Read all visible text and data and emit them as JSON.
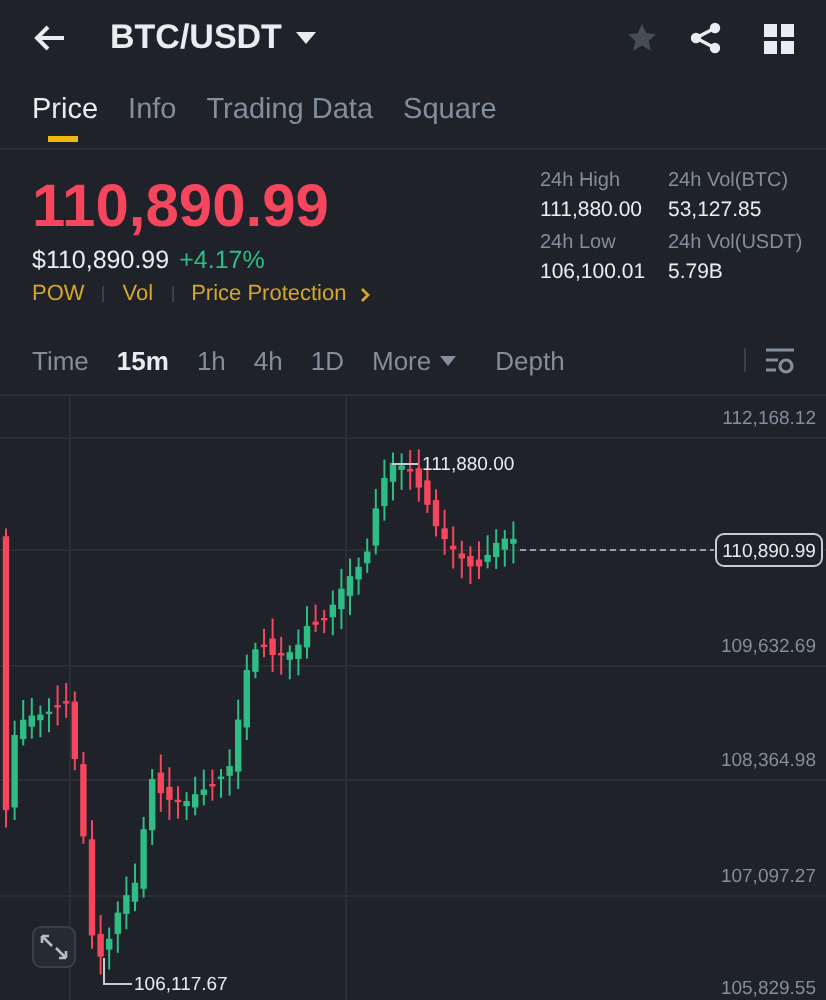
{
  "header": {
    "title": "BTC/USDT",
    "starred": false
  },
  "tabs": [
    {
      "label": "Price",
      "selected": true
    },
    {
      "label": "Info",
      "selected": false
    },
    {
      "label": "Trading Data",
      "selected": false
    },
    {
      "label": "Square",
      "selected": false
    }
  ],
  "price": {
    "last": "110,890.99",
    "usd": "$110,890.99",
    "change": "+4.17%"
  },
  "tags": [
    {
      "label": "POW",
      "kind": "tag"
    },
    {
      "label": "Vol",
      "kind": "tag"
    },
    {
      "label": "Price Protection",
      "kind": "link"
    }
  ],
  "stats": [
    {
      "label": "24h High",
      "value": "111,880.00"
    },
    {
      "label": "24h Vol(BTC)",
      "value": "53,127.85"
    },
    {
      "label": "24h Low",
      "value": "106,100.01"
    },
    {
      "label": "24h Vol(USDT)",
      "value": "5.79B"
    }
  ],
  "intervals": [
    {
      "label": "Time",
      "kind": "interval",
      "selected": false
    },
    {
      "label": "15m",
      "kind": "interval",
      "selected": true
    },
    {
      "label": "1h",
      "kind": "interval",
      "selected": false
    },
    {
      "label": "4h",
      "kind": "interval",
      "selected": false
    },
    {
      "label": "1D",
      "kind": "interval",
      "selected": false
    },
    {
      "label": "More",
      "kind": "dropdown",
      "selected": false
    },
    {
      "label": "Depth",
      "kind": "interval",
      "selected": false
    }
  ],
  "chart": {
    "price_axis": [
      "112,168.12",
      "109,632.69",
      "108,364.98",
      "107,097.27",
      "105,829.55"
    ],
    "high_marker": "111,880.00",
    "low_marker": "106,117.67",
    "current_price": "110,890.99"
  }
}
